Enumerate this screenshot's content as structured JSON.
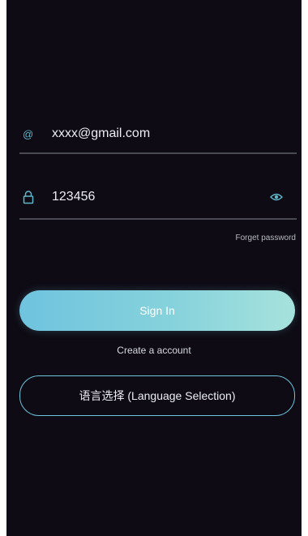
{
  "login": {
    "email_value": "xxxx@gmail.com",
    "email_icon": "@",
    "password_value": "123456",
    "forget_password_label": "Forget password",
    "sign_in_label": "Sign In",
    "create_account_label": "Create a account",
    "language_button_label": "语言选择 (Language Selection)"
  },
  "icons": {
    "email": "at-sign-icon",
    "password": "lock-icon",
    "visibility": "eye-icon"
  },
  "colors": {
    "background": "#0e0b14",
    "accent": "#6fc3de",
    "button_gradient_end": "#a6e2dc"
  }
}
